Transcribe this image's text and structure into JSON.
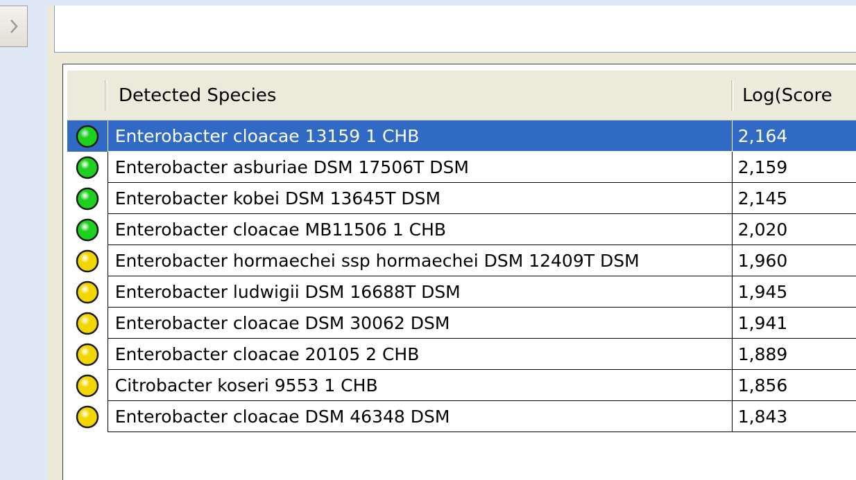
{
  "table": {
    "columns": [
      {
        "label": ""
      },
      {
        "label": "Detected Species"
      },
      {
        "label": "Log(Score"
      }
    ],
    "rows": [
      {
        "status": "green",
        "species": "Enterobacter cloacae 13159  1 CHB",
        "score": "2,164",
        "selected": true
      },
      {
        "status": "green",
        "species": "Enterobacter asburiae DSM 17506T DSM",
        "score": "2,159",
        "selected": false
      },
      {
        "status": "green",
        "species": "Enterobacter kobei DSM 13645T DSM",
        "score": "2,145",
        "selected": false
      },
      {
        "status": "green",
        "species": "Enterobacter cloacae MB11506  1 CHB",
        "score": "2,020",
        "selected": false
      },
      {
        "status": "yellow",
        "species": "Enterobacter hormaechei ssp hormaechei DSM 12409T DSM",
        "score": "1,960",
        "selected": false
      },
      {
        "status": "yellow",
        "species": "Enterobacter ludwigii DSM 16688T DSM",
        "score": "1,945",
        "selected": false
      },
      {
        "status": "yellow",
        "species": "Enterobacter cloacae DSM 30062 DSM",
        "score": "1,941",
        "selected": false
      },
      {
        "status": "yellow",
        "species": "Enterobacter cloacae 20105  2 CHB",
        "score": "1,889",
        "selected": false
      },
      {
        "status": "yellow",
        "species": "Citrobacter koseri 9553  1 CHB",
        "score": "1,856",
        "selected": false
      },
      {
        "status": "yellow",
        "species": "Enterobacter cloacae DSM 46348 DSM",
        "score": "1,843",
        "selected": false
      }
    ]
  },
  "colors": {
    "selection": "#316ac5",
    "status_green": "#1fd11f",
    "status_yellow": "#f2d600"
  },
  "icons": {
    "expand": "chevron-right-icon",
    "status_green": "green-status-icon",
    "status_yellow": "yellow-status-icon"
  }
}
